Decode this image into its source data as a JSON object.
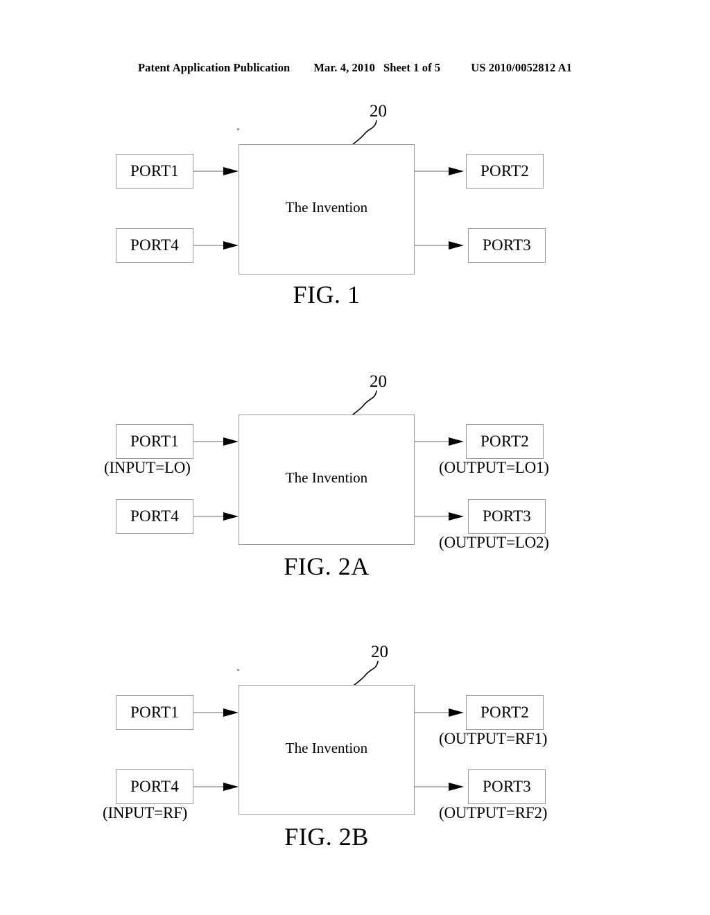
{
  "header": {
    "publication": "Patent Application Publication",
    "date": "Mar. 4, 2010",
    "sheet": "Sheet 1 of 5",
    "patent_number": "US 2010/0052812 A1"
  },
  "colors": {
    "ink": "#000000",
    "box_stroke": "#9a9a9a",
    "page_background": "#ffffff"
  },
  "figures": [
    {
      "id": "fig-1",
      "caption": "FIG. 1",
      "reference_numeral": "20",
      "core_label": "The Invention",
      "ports": {
        "left_top": {
          "label": "PORT1",
          "sublabel": ""
        },
        "left_bottom": {
          "label": "PORT4",
          "sublabel": ""
        },
        "right_top": {
          "label": "PORT2",
          "sublabel": ""
        },
        "right_bottom": {
          "label": "PORT3",
          "sublabel": ""
        }
      }
    },
    {
      "id": "fig-2a",
      "caption": "FIG. 2A",
      "reference_numeral": "20",
      "core_label": "The Invention",
      "ports": {
        "left_top": {
          "label": "PORT1",
          "sublabel": "(INPUT=LO)"
        },
        "left_bottom": {
          "label": "PORT4",
          "sublabel": ""
        },
        "right_top": {
          "label": "PORT2",
          "sublabel": "(OUTPUT=LO1)"
        },
        "right_bottom": {
          "label": "PORT3",
          "sublabel": "(OUTPUT=LO2)"
        }
      }
    },
    {
      "id": "fig-2b",
      "caption": "FIG. 2B",
      "reference_numeral": "20",
      "core_label": "The Invention",
      "ports": {
        "left_top": {
          "label": "PORT1",
          "sublabel": ""
        },
        "left_bottom": {
          "label": "PORT4",
          "sublabel": "(INPUT=RF)"
        },
        "right_top": {
          "label": "PORT2",
          "sublabel": "(OUTPUT=RF1)"
        },
        "right_bottom": {
          "label": "PORT3",
          "sublabel": "(OUTPUT=RF2)"
        }
      }
    }
  ]
}
